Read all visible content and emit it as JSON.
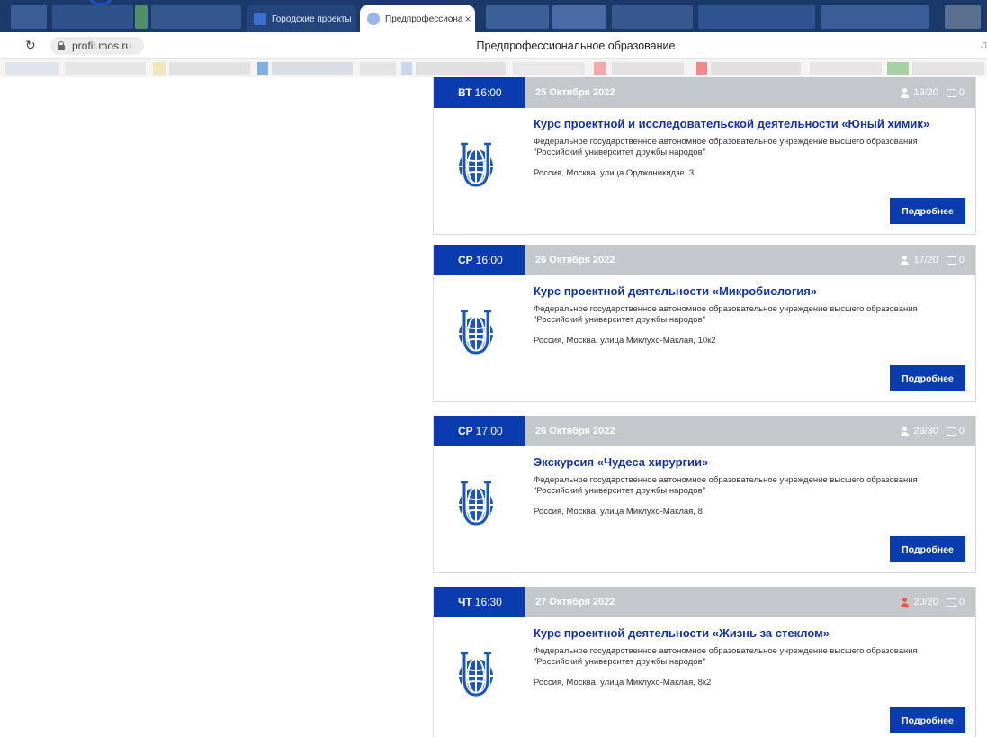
{
  "browser": {
    "tabs": [
      {
        "label": "Городские проекты"
      },
      {
        "label": "Предпрофессиона",
        "close": "×"
      }
    ],
    "reload_glyph": "↻",
    "url": "profil.mos.ru",
    "page_heading": "Предпрофессиональное образование",
    "edge_glyph": "л",
    "colors": {
      "tab_strip": "#1b3a6b",
      "accent": "#0a3cb0",
      "header_gray": "#c4c7cc",
      "title_blue": "#1333a3",
      "full_red": "#e8584c"
    }
  },
  "events": [
    {
      "day": "ВТ",
      "time": "16:00",
      "date": "25 Октября 2022",
      "seats": "19/20",
      "seats_full": false,
      "comments": "0",
      "title": "Курс проектной и исследовательской деятельности «Юный химик»",
      "org": "Федеральное государственное автономное образовательное учреждение высшего образования \"Российский университет дружбы народов\"",
      "address": "Россия, Москва, улица Орджоникидзе, 3",
      "button": "Подробнее"
    },
    {
      "day": "СР",
      "time": "16:00",
      "date": "26 Октября 2022",
      "seats": "17/20",
      "seats_full": false,
      "comments": "0",
      "title": "Курс проектной деятельности «Микробиология»",
      "org": "Федеральное государственное автономное образовательное учреждение высшего образования \"Российский университет дружбы народов\"",
      "address": "Россия, Москва, улица Миклухо-Маклая, 10к2",
      "button": "Подробнее"
    },
    {
      "day": "СР",
      "time": "17:00",
      "date": "26 Октября 2022",
      "seats": "29/30",
      "seats_full": false,
      "comments": "0",
      "title": "Экскурсия «Чудеса хирургии»",
      "org": "Федеральное государственное автономное образовательное учреждение высшего образования \"Российский университет дружбы народов\"",
      "address": "Россия, Москва, улица Миклухо-Маклая, 8",
      "button": "Подробнее"
    },
    {
      "day": "ЧТ",
      "time": "16:30",
      "date": "27 Октября 2022",
      "seats": "20/20",
      "seats_full": true,
      "comments": "0",
      "title": "Курс проектной деятельности «Жизнь за стеклом»",
      "org": "Федеральное государственное автономное образовательное учреждение высшего образования \"Российский университет дружбы народов\"",
      "address": "Россия, Москва, улица Миклухо-Маклая, 8к2",
      "button": "Подробнее"
    }
  ]
}
